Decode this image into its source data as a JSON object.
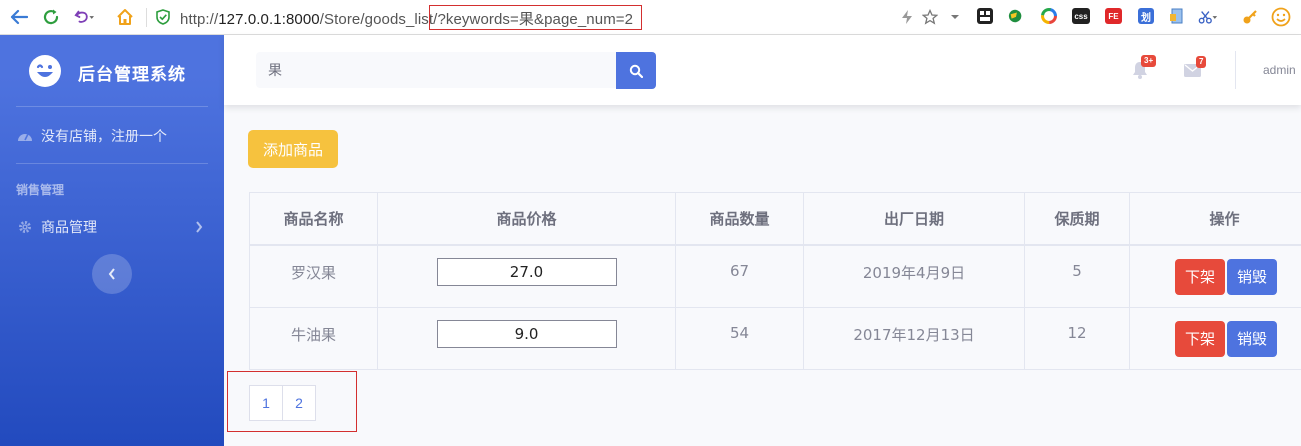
{
  "browser": {
    "url_prefix": "http://",
    "url_host": "127.0.0.1:8000",
    "url_path": "/Store/goods_list",
    "url_query": "/?keywords=果&page_num=2",
    "ext_css_label": "css",
    "ext_fe_label": "FE",
    "ext_hua_label": "划"
  },
  "sidebar": {
    "brand": "后台管理系统",
    "shop_link": "没有店铺，注册一个",
    "section_heading": "销售管理",
    "goods_menu": "商品管理"
  },
  "topbar": {
    "search_value": "果",
    "alerts_badge": "3+",
    "messages_badge": "7",
    "user_name": "admin"
  },
  "content": {
    "add_button": "添加商品",
    "table": {
      "headers": [
        "商品名称",
        "商品价格",
        "商品数量",
        "出厂日期",
        "保质期",
        "操作"
      ],
      "rows": [
        {
          "name": "罗汉果",
          "price": "27.0",
          "quantity": "67",
          "date": "2019年4月9日",
          "shelf_life": "5",
          "action_off": "下架",
          "action_destroy": "销毁"
        },
        {
          "name": "牛油果",
          "price": "9.0",
          "quantity": "54",
          "date": "2017年12月13日",
          "shelf_life": "12",
          "action_off": "下架",
          "action_destroy": "销毁"
        }
      ]
    },
    "pagination": [
      "1",
      "2"
    ]
  },
  "colors": {
    "primary": "#4e73df",
    "warning": "#f6c23e",
    "danger": "#e74a3b",
    "annotation_red": "#d32f2f"
  }
}
